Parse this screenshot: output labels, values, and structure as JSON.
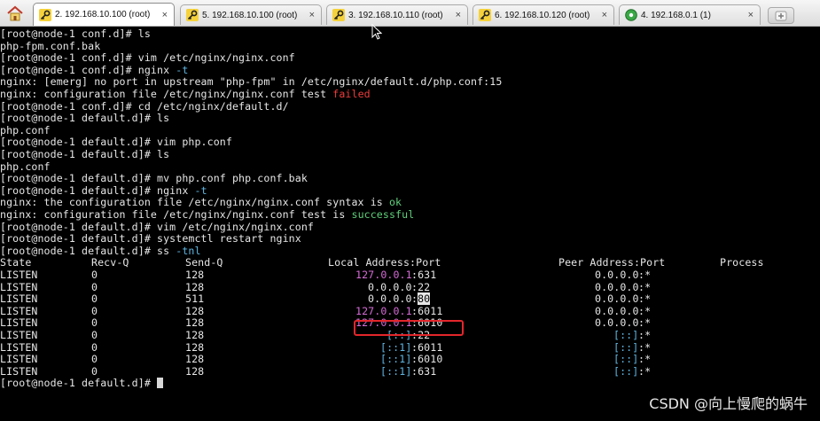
{
  "tabs": [
    {
      "label": "2. 192.168.10.100 (root)",
      "active": true,
      "icon": "key-icon",
      "closable": true
    },
    {
      "label": "5. 192.168.10.100 (root)",
      "active": false,
      "icon": "key-icon",
      "closable": true
    },
    {
      "label": "3. 192.168.10.110 (root)",
      "active": false,
      "icon": "key-icon",
      "closable": true
    },
    {
      "label": "6. 192.168.10.120 (root)",
      "active": false,
      "icon": "key-icon",
      "closable": true
    },
    {
      "label": "4. 192.168.0.1 (1)",
      "active": false,
      "icon": "globe-icon",
      "closable": true
    }
  ],
  "tab_close_glyph": "×",
  "lines": [
    "[root@node-1 conf.d]# ls",
    "php-fpm.conf.bak",
    "[root@node-1 conf.d]# vim /etc/nginx/nginx.conf",
    "[root@node-1 conf.d]# nginx -t",
    "nginx: [emerg] no port in upstream \"php-fpm\" in /etc/nginx/default.d/php.conf:15",
    "nginx: configuration file /etc/nginx/nginx.conf test failed",
    "[root@node-1 conf.d]# cd /etc/nginx/default.d/",
    "[root@node-1 default.d]# ls",
    "php.conf",
    "[root@node-1 default.d]# vim php.conf",
    "[root@node-1 default.d]# ls",
    "php.conf",
    "[root@node-1 default.d]# mv php.conf php.conf.bak",
    "[root@node-1 default.d]# nginx -t",
    "nginx: the configuration file /etc/nginx/nginx.conf syntax is ok",
    "nginx: configuration file /etc/nginx/nginx.conf test is successful",
    "[root@node-1 default.d]# vim /etc/nginx/nginx.conf",
    "[root@node-1 default.d]# systemctl restart nginx",
    "[root@node-1 default.d]# ss -tnl"
  ],
  "ss_header": {
    "state": "State",
    "recvq": "Recv-Q",
    "sendq": "Send-Q",
    "local": "Local Address:Port",
    "peer": "Peer Address:Port",
    "process": "Process"
  },
  "ss_rows": [
    {
      "state": "LISTEN",
      "recvq": "0",
      "sendq": "128",
      "local_addr": "127.0.0.1",
      "local_port": "631",
      "peer_addr": "0.0.0.0",
      "peer_port": "*"
    },
    {
      "state": "LISTEN",
      "recvq": "0",
      "sendq": "128",
      "local_addr": "0.0.0.0",
      "local_port": "22",
      "peer_addr": "0.0.0.0",
      "peer_port": "*"
    },
    {
      "state": "LISTEN",
      "recvq": "0",
      "sendq": "511",
      "local_addr": "0.0.0.0",
      "local_port": "80",
      "peer_addr": "0.0.0.0",
      "peer_port": "*"
    },
    {
      "state": "LISTEN",
      "recvq": "0",
      "sendq": "128",
      "local_addr": "127.0.0.1",
      "local_port": "6011",
      "peer_addr": "0.0.0.0",
      "peer_port": "*"
    },
    {
      "state": "LISTEN",
      "recvq": "0",
      "sendq": "128",
      "local_addr": "127.0.0.1",
      "local_port": "6010",
      "peer_addr": "0.0.0.0",
      "peer_port": "*"
    },
    {
      "state": "LISTEN",
      "recvq": "0",
      "sendq": "128",
      "local_addr": "[::]",
      "local_port": "22",
      "peer_addr": "[::]",
      "peer_port": "*"
    },
    {
      "state": "LISTEN",
      "recvq": "0",
      "sendq": "128",
      "local_addr": "[::1]",
      "local_port": "6011",
      "peer_addr": "[::]",
      "peer_port": "*"
    },
    {
      "state": "LISTEN",
      "recvq": "0",
      "sendq": "128",
      "local_addr": "[::1]",
      "local_port": "6010",
      "peer_addr": "[::]",
      "peer_port": "*"
    },
    {
      "state": "LISTEN",
      "recvq": "0",
      "sendq": "128",
      "local_addr": "[::1]",
      "local_port": "631",
      "peer_addr": "[::]",
      "peer_port": "*"
    }
  ],
  "final_prompt": "[root@node-1 default.d]# ",
  "watermark": "CSDN @向上慢爬的蜗牛",
  "colors": {
    "failed": "#ef3b3b",
    "ok": "#5fd07a",
    "flag": "#5fb5e0",
    "ipv4_loopback": "#d66bd6",
    "ipv6": "#5fb5e0",
    "highlight_box": "#e3262b"
  }
}
